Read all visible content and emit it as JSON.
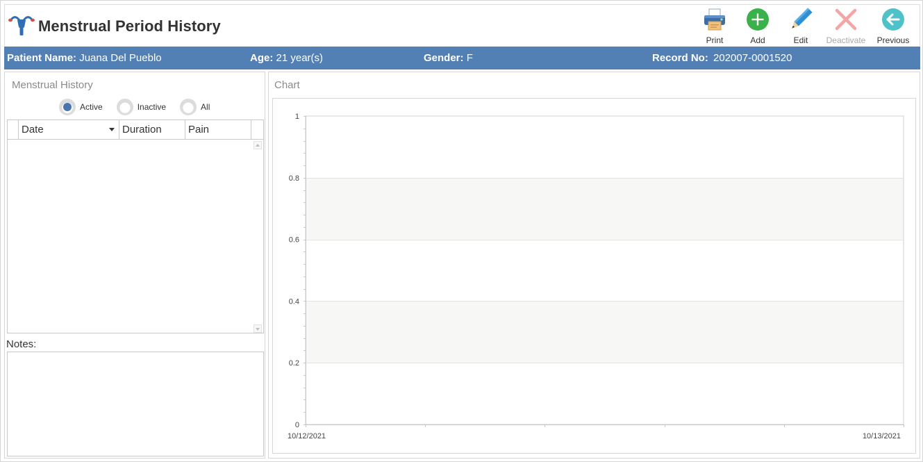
{
  "header": {
    "title": "Menstrual Period History",
    "logo_icon": "uterus-icon"
  },
  "toolbar": {
    "print_label": "Print",
    "add_label": "Add",
    "edit_label": "Edit",
    "deactivate_label": "Deactivate",
    "previous_label": "Previous"
  },
  "patient": {
    "name_label": "Patient Name:",
    "name_value": "Juana Del Pueblo",
    "age_label": "Age:",
    "age_value": "21 year(s)",
    "gender_label": "Gender:",
    "gender_value": "F",
    "record_label": "Record No:",
    "record_value": "202007-0001520"
  },
  "left": {
    "section_title": "Menstrual History",
    "filters": [
      {
        "label": "Active",
        "selected": true
      },
      {
        "label": "Inactive",
        "selected": false
      },
      {
        "label": "All",
        "selected": false
      }
    ],
    "columns": [
      "Date",
      "Duration",
      "Pain"
    ],
    "rows": [],
    "notes_label": "Notes:",
    "notes_value": ""
  },
  "right": {
    "section_title": "Chart"
  },
  "colors": {
    "accent": "#5280b5",
    "radio_dot": "#4a76ad",
    "add_green": "#3bb14b",
    "edit_blue": "#2f8fd0",
    "deactivate_red": "#f4a6a6",
    "previous_teal": "#4fc1c9"
  },
  "chart_data": {
    "type": "line",
    "title": "",
    "xlabel": "",
    "ylabel": "",
    "x_ticks": [
      "10/12/2021",
      "10/13/2021"
    ],
    "y_ticks": [
      "0",
      "0.2",
      "0.4",
      "0.6",
      "0.8",
      "1"
    ],
    "ylim": [
      0,
      1
    ],
    "series": [],
    "grid": true,
    "banded_background": true
  }
}
